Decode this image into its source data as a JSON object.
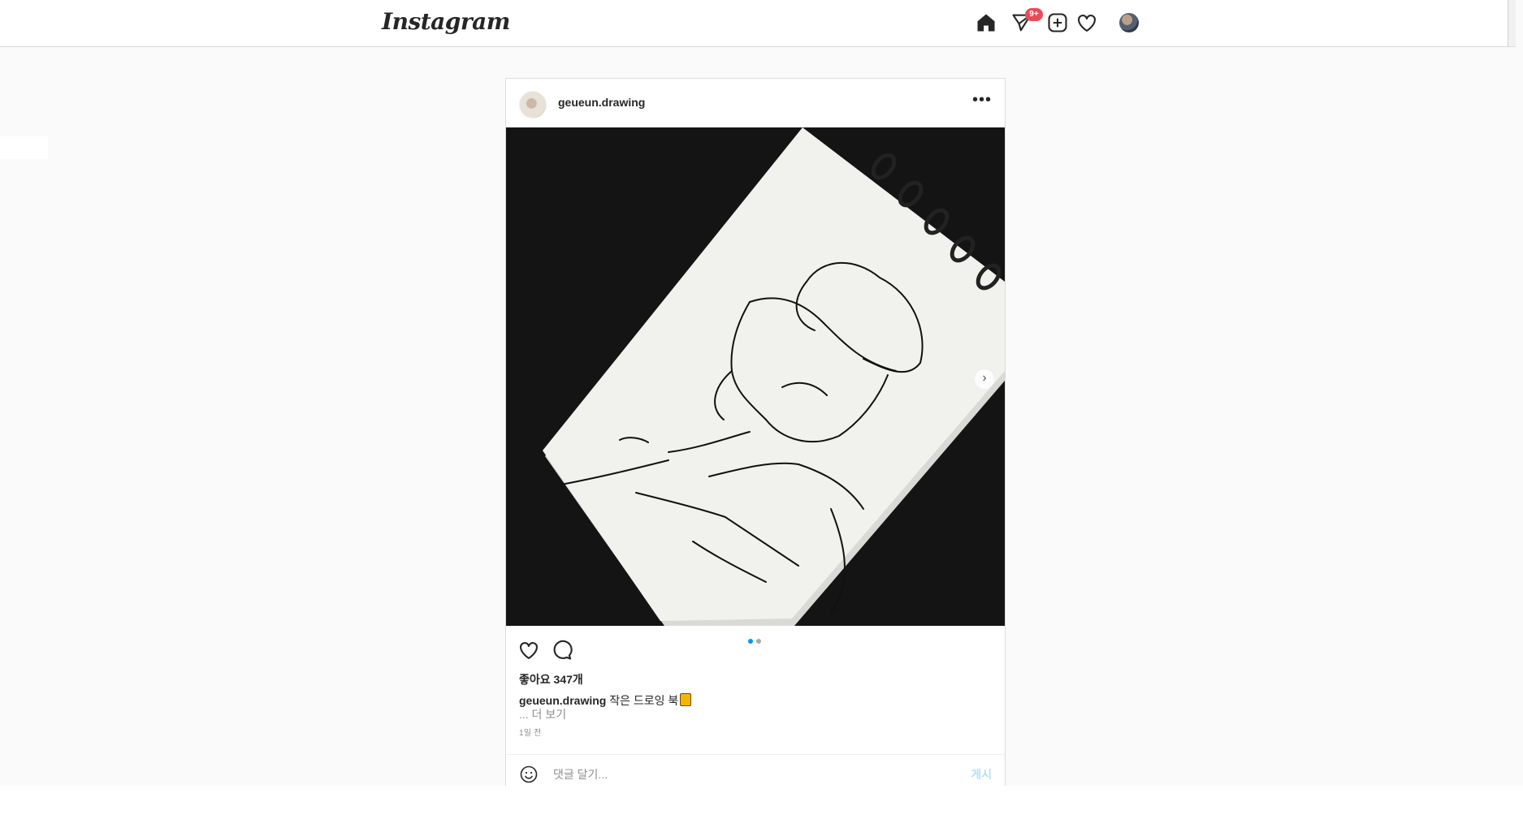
{
  "nav": {
    "logo": "Instagram",
    "direct_badge": "9+",
    "icons": [
      "home-icon",
      "direct-message-icon",
      "new-post-icon",
      "activity-heart-icon",
      "profile-avatar"
    ]
  },
  "post": {
    "username": "geueun.drawing",
    "more_symbol": "•••",
    "image_alt": "Pen sketch of a man in a cap on a spiral sketchbook",
    "carousel": {
      "count": 2,
      "active_index": 0,
      "next_symbol": "›"
    },
    "likes": "좋아요 347개",
    "caption": {
      "username": "geueun.drawing",
      "text": "작은 드로잉 북"
    },
    "more_text": "... 더 보기",
    "time": "1일 전",
    "comment": {
      "placeholder": "댓글 달기...",
      "value": "",
      "post_label": "게시"
    }
  },
  "colors": {
    "accent_blue": "#0095f6",
    "post_disabled": "#b2dffc",
    "badge_red": "#ed4956",
    "border": "#dbdbdb"
  }
}
